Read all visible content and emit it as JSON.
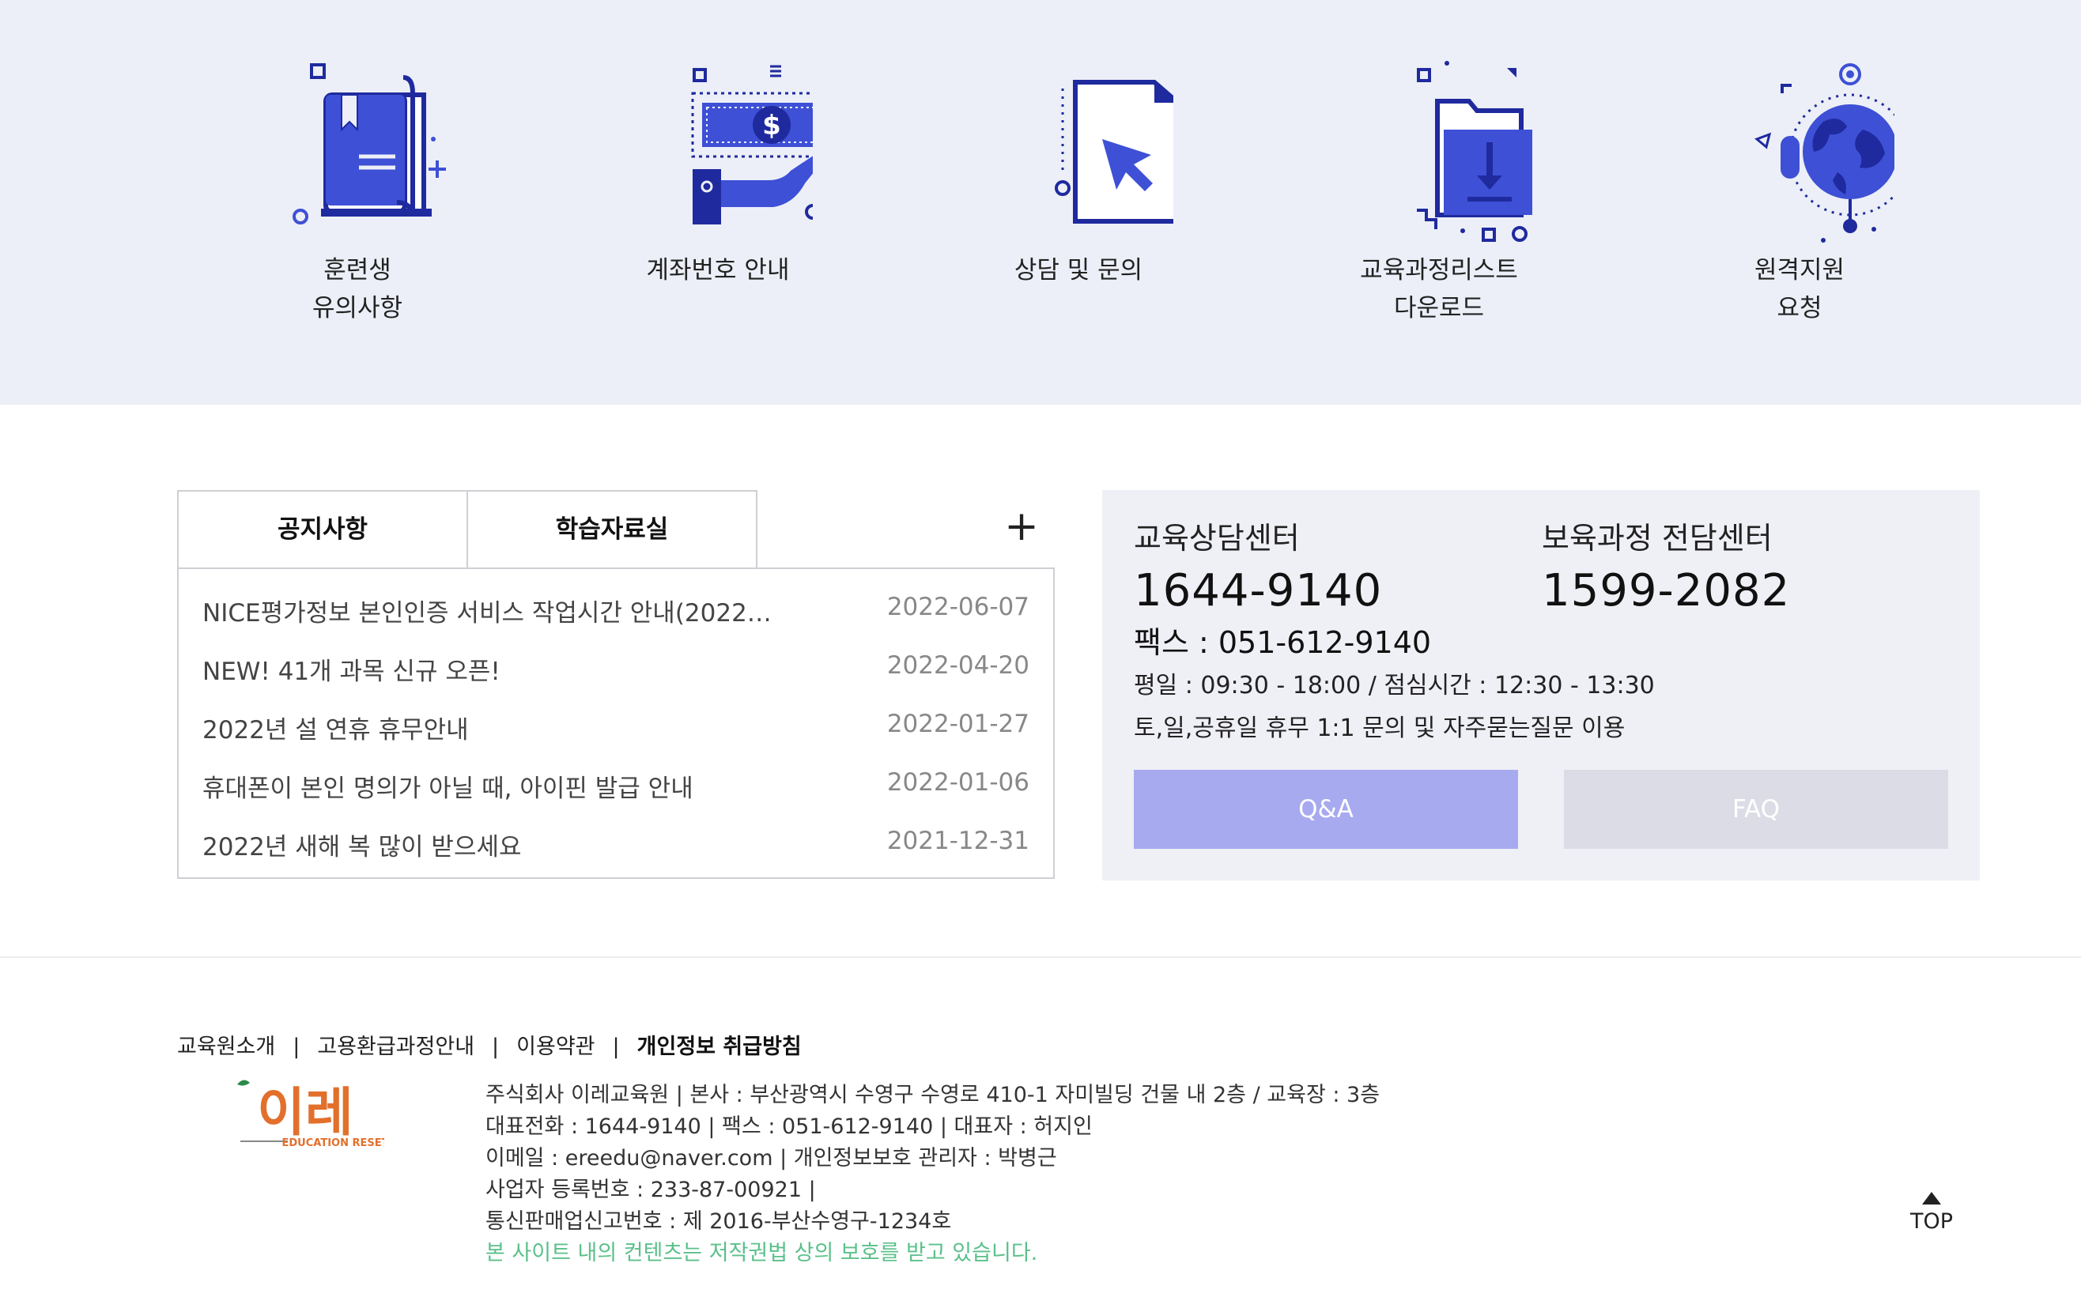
{
  "quick_menu": [
    {
      "label": "훈련생\n유의사항",
      "icon": "book-icon"
    },
    {
      "label": "계좌번호 안내",
      "icon": "money-hand-icon"
    },
    {
      "label": "상담 및 문의",
      "icon": "document-cursor-icon"
    },
    {
      "label": "교육과정리스트\n다운로드",
      "icon": "folder-download-icon"
    },
    {
      "label": "원격지원\n요청",
      "icon": "globe-pin-icon"
    }
  ],
  "notice": {
    "tabs": [
      "공지사항",
      "학습자료실"
    ],
    "more_label": "+",
    "items": [
      {
        "title": "NICE평가정보 본인인증 서비스 작업시간 안내(2022…",
        "date": "2022-06-07"
      },
      {
        "title": "NEW! 41개 과목 신규 오픈!",
        "date": "2022-04-20"
      },
      {
        "title": "2022년 설 연휴 휴무안내",
        "date": "2022-01-27"
      },
      {
        "title": "휴대폰이 본인 명의가 아닐 때, 아이핀 발급 안내",
        "date": "2022-01-06"
      },
      {
        "title": "2022년 새해 복 많이 받으세요",
        "date": "2021-12-31"
      }
    ]
  },
  "contact": {
    "center1_label": "교육상담센터",
    "center1_number": "1644-9140",
    "center2_label": "보육과정 전담센터",
    "center2_number": "1599-2082",
    "fax": "팩스 : 051-612-9140",
    "hours": "평일 : 09:30 - 18:00 / 점심시간 : 12:30 - 13:30",
    "holiday": "토,일,공휴일 휴무 1:1 문의 및 자주묻는질문 이용",
    "qa_label": "Q&A",
    "faq_label": "FAQ"
  },
  "footer": {
    "links": [
      "교육원소개",
      "고용환급과정안내",
      "이용약관",
      "개인정보 취급방침"
    ],
    "sep": "|",
    "logo_text": "이레",
    "logo_sub": "EDUCATION RESET",
    "info_lines": [
      "주식회사 이레교육원   |  본사 : 부산광역시 수영구 수영로 410-1 자미빌딩 건물 내 2층 / 교육장 : 3층",
      "대표전화 : 1644-9140    |  팩스 : 051-612-9140    |  대표자 : 허지인",
      "이메일 : ereedu@naver.com   |  개인정보보호 관리자 : 박병근",
      "사업자 등록번호 : 233-87-00921   |",
      "통신판매업신고번호 : 제 2016-부산수영구-1234호"
    ],
    "copyright": "본 사이트 내의 컨텐츠는 저작권법 상의 보호를 받고 있습니다.",
    "top_label": "TOP"
  },
  "colors": {
    "accent_blue": "#3e50d6",
    "navy": "#1f2a9e",
    "band_bg": "#eceff7",
    "qa_button": "#a7aaee",
    "faq_button": "#dcdce6",
    "copyright_green": "#5bc08a",
    "logo_orange": "#e2702c"
  }
}
